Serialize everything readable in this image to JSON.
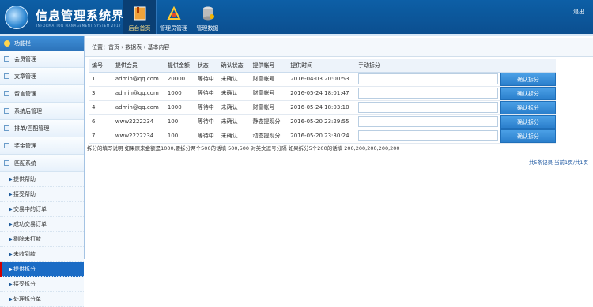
{
  "header": {
    "title": "信息管理系统界面",
    "subtitle": "INFORMATION MANAGEMENT SYSTEM 2017",
    "exit": "退出",
    "nav": [
      {
        "label": "后台首页",
        "icon": "document-icon"
      },
      {
        "label": "管理员管理",
        "icon": "tools-icon"
      },
      {
        "label": "管理数据",
        "icon": "database-icon"
      }
    ]
  },
  "sidebar": {
    "heading": "功能栏",
    "menus": [
      "会员管理",
      "文章管理",
      "留言管理",
      "系统后管理",
      "排单/匹配管理",
      "奖金管理",
      "匹配系统"
    ],
    "subs": [
      "提供帮助",
      "接受帮助",
      "交易中的订单",
      "成功交易订单",
      "剔除未打款",
      "未收到款",
      "提供拆分",
      "接受拆分",
      "处理拆分单"
    ],
    "active_sub": "提供拆分"
  },
  "breadcrumb": {
    "prefix": "位置：",
    "items": [
      "首页",
      "数据表",
      "基本内容"
    ],
    "sep": "›"
  },
  "table": {
    "headers": [
      "编号",
      "提供会员",
      "提供金额",
      "状态",
      "确认状态",
      "提供帐号",
      "提供时间",
      "手动拆分",
      ""
    ],
    "rows": [
      [
        "1",
        "admin@qq.com",
        "20000",
        "等待中",
        "未确认",
        "财富帐号",
        "2016-04-03 20:00:53"
      ],
      [
        "3",
        "admin@qq.com",
        "1000",
        "等待中",
        "未确认",
        "财富帐号",
        "2016-05-24 18:01:47"
      ],
      [
        "4",
        "admin@qq.com",
        "1000",
        "等待中",
        "未确认",
        "财富帐号",
        "2016-05-24 18:03:10"
      ],
      [
        "6",
        "www2222234",
        "100",
        "等待中",
        "未确认",
        "静态提现分",
        "2016-05-20 23:29:55"
      ],
      [
        "7",
        "www2222234",
        "100",
        "等待中",
        "未确认",
        "动态提现分",
        "2016-05-20 23:30:24"
      ]
    ],
    "button": "确认拆分"
  },
  "note": "拆分的填写说明 如果原来金额是1000,要拆分两个500的话填 500,500 对英文逗号分隔 如果拆分5个200的话填 200,200,200,200,200",
  "pager": "共5条记录 当前1页/共1页"
}
